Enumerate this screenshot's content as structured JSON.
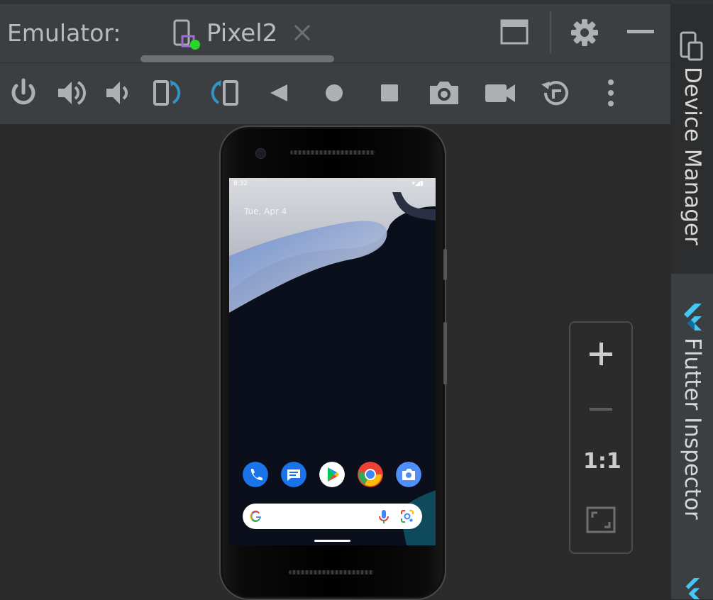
{
  "window": {
    "label": "Emulator:",
    "tab_name": "Pixel2",
    "tab_close_icon": "close-icon",
    "device_icon": "device-running-icon"
  },
  "top_actions": [
    "window-restore-icon",
    "settings-gear-icon",
    "minimize-icon"
  ],
  "toolbar": {
    "buttons": [
      {
        "name": "power-button",
        "icon": "power-icon"
      },
      {
        "name": "volume-up-button",
        "icon": "volume-up-icon"
      },
      {
        "name": "volume-down-button",
        "icon": "volume-down-icon"
      },
      {
        "name": "rotate-left-button",
        "icon": "rotate-left-icon"
      },
      {
        "name": "rotate-right-button",
        "icon": "rotate-right-icon"
      },
      {
        "name": "back-button",
        "icon": "back-triangle-icon"
      },
      {
        "name": "home-button",
        "icon": "home-circle-icon"
      },
      {
        "name": "overview-button",
        "icon": "overview-square-icon"
      },
      {
        "name": "screenshot-button",
        "icon": "camera-icon"
      },
      {
        "name": "screen-record-button",
        "icon": "video-camera-icon"
      },
      {
        "name": "snapshot-button",
        "icon": "snapshot-restore-icon"
      },
      {
        "name": "more-options-button",
        "icon": "more-vertical-icon"
      }
    ],
    "accent": "#3592c4"
  },
  "right_sidebar": {
    "tools": [
      {
        "label": "Device Manager",
        "icon": "device-manager-icon",
        "active": true
      },
      {
        "label": "Flutter Inspector",
        "icon": "flutter-icon",
        "active": false
      }
    ]
  },
  "zoom_panel": {
    "zoom_in_icon": "plus-icon",
    "zoom_out_icon": "minus-icon",
    "actual_size_label": "1:1",
    "fit_screen_icon": "fit-screen-icon"
  },
  "phone": {
    "status_time": "8:32",
    "date": "Tue, Apr 4",
    "dock_apps": [
      "Phone",
      "Messages",
      "Play Store",
      "Chrome",
      "Camera"
    ],
    "search_logo": "G"
  },
  "colors": {
    "panel_bg": "#3c3f41",
    "canvas_bg": "#2b2b2b",
    "status_green": "#2bd62b",
    "flutter_blue": "#44c7f5"
  }
}
